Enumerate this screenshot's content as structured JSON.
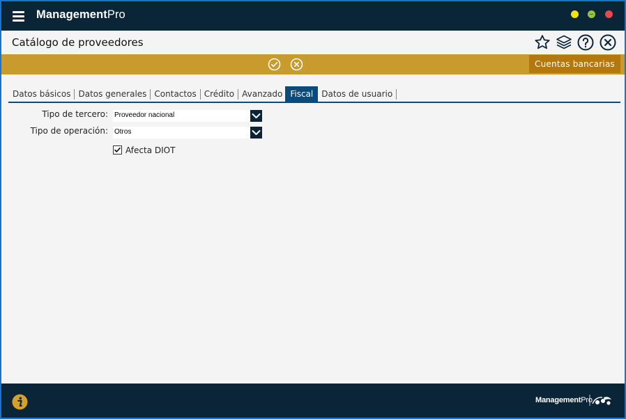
{
  "app": {
    "name_bold": "Management",
    "name_light": "Pro"
  },
  "window": {
    "minimize_color": "#f2e600",
    "maximize_color": "#9bc23c",
    "close_color": "#e5484d"
  },
  "header": {
    "title": "Catálogo de proveedores",
    "icons": [
      "star-icon",
      "layers-icon",
      "help-icon",
      "close-circle-icon"
    ]
  },
  "actionbar": {
    "icons": [
      "accept-check-icon",
      "cancel-x-icon"
    ],
    "bank_button_label": "Cuentas bancarias"
  },
  "tabs": [
    {
      "label": "Datos básicos"
    },
    {
      "label": "Datos generales"
    },
    {
      "label": "Contactos"
    },
    {
      "label": "Crédito"
    },
    {
      "label": "Avanzado"
    },
    {
      "label": "Fiscal",
      "active": true
    },
    {
      "label": "Datos de usuario"
    }
  ],
  "form": {
    "tipo_tercero_label": "Tipo de tercero:",
    "tipo_tercero_value": "Proveedor nacional",
    "tipo_operacion_label": "Tipo de operación:",
    "tipo_operacion_value": "Otros",
    "afecta_diot_label": "Afecta DIOT",
    "afecta_diot_checked": true
  },
  "footer": {
    "logo_bold": "Management",
    "logo_light": "Pro"
  },
  "colors": {
    "topbar": "#0b2538",
    "actionbar": "#c99a2e",
    "bank_button": "#b5780f",
    "tab_active": "#0b4a7c",
    "footer": "#0b2538"
  }
}
